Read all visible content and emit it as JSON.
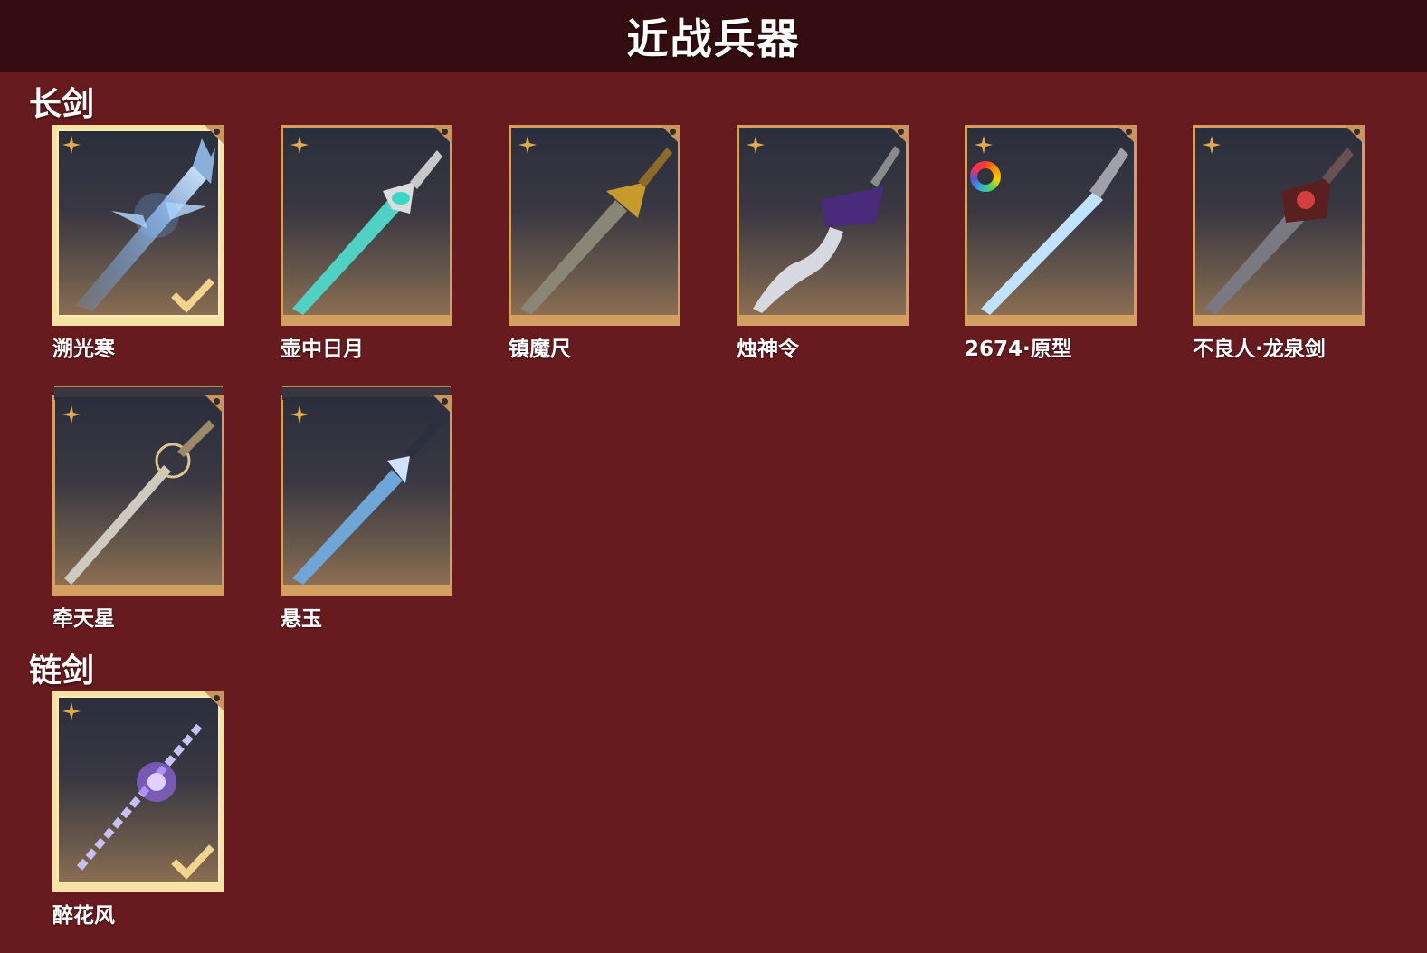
{
  "header": {
    "title": "近战兵器"
  },
  "sections": [
    {
      "title": "长剑",
      "items": [
        {
          "name": "溯光寒",
          "equipped": true
        },
        {
          "name": "壶中日月",
          "equipped": false
        },
        {
          "name": "镇魔尺",
          "equipped": false
        },
        {
          "name": "烛神令",
          "equipped": false
        },
        {
          "name": "2674·原型",
          "equipped": false,
          "color_variant_icon": "color-wheel-icon"
        },
        {
          "name": "不良人·龙泉剑",
          "equipped": false
        },
        {
          "name": "牵天星",
          "equipped": false
        },
        {
          "name": "悬玉",
          "equipped": false
        }
      ]
    },
    {
      "title": "链剑",
      "items": [
        {
          "name": "醉花风",
          "equipped": true
        }
      ]
    }
  ],
  "icons": {
    "rarity": "four-point-star-icon",
    "equipped": "checkmark-icon"
  },
  "colors": {
    "background": "#671b1f",
    "header": "#330d10",
    "card_frame": "#d4a062",
    "selected_frame": "#f6e2a4",
    "rarity_star": "#e2a94e"
  }
}
